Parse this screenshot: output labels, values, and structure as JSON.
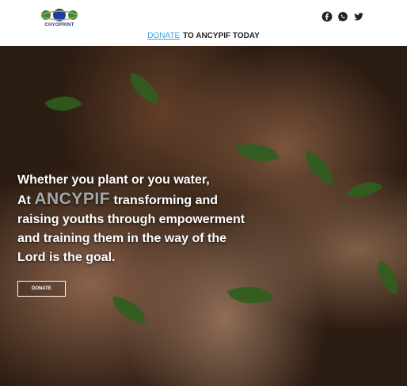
{
  "brand": {
    "logo_text": "CHYOPRINT"
  },
  "social": {
    "icons": [
      "facebook-icon",
      "whatsapp-icon",
      "twitter-icon"
    ]
  },
  "donate_strip": {
    "link": "DONATE",
    "text": "TO ANCYPIF TODAY"
  },
  "hero": {
    "line1": "Whether you plant or you water,",
    "at": "At",
    "brand": "ANCYPIF",
    "line2_rest": "transforming and raising youths through empowerment and training them in the way of the Lord is the goal.",
    "button": "DONATE"
  },
  "colors": {
    "link": "#3aa0d8",
    "brand_muted": "#a7a7a7",
    "logo_blue": "#2b3a8f"
  }
}
